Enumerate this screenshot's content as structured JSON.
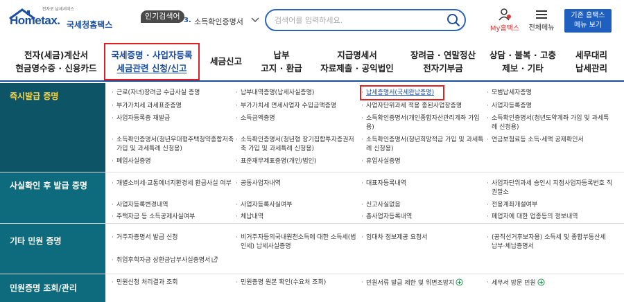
{
  "header": {
    "logo_slogan": "전자로 납세서비스",
    "logo_text": "Hometax.",
    "logo_org": "국세청홈택스",
    "popular_label": "인기검색어",
    "popular_rank": "3.",
    "popular_term": "소득확인증명서",
    "search_placeholder": "검색어를 입력하세요.",
    "my_hometax": "My홈택스",
    "all_menu": "전체메뉴",
    "classic_line1": "기존 홈택스",
    "classic_line2": "메뉴 보기"
  },
  "gnb": [
    {
      "line1": "전자(세금)계산서",
      "line2": "현금영수증 · 신용카드"
    },
    {
      "line1": "국세증명 · 사업자등록",
      "line2": "세금관련 신청/신고"
    },
    {
      "line1": "세금신고",
      "line2": ""
    },
    {
      "line1": "납부",
      "line2": "고지 · 환급"
    },
    {
      "line1": "지급명세서",
      "line2": "자료제출 · 공익법인"
    },
    {
      "line1": "장려금 · 연말정산",
      "line2": "전자기부금"
    },
    {
      "line1": "상담 · 불복 · 고충",
      "line2": "제보 · 기타"
    },
    {
      "line1": "세무대리",
      "line2": "납세관리"
    }
  ],
  "categories": [
    "즉시발급 증명",
    "사실확인 후 발급 증명",
    "기타 민원 증명",
    "민원증명 조회/관리"
  ],
  "items": {
    "c1": [
      "근로(자녀)장려금 수급사실 증명",
      "납부내역증명(납세사실증명)",
      "납세증명서(국세완납증명)",
      "모범납세자증명",
      "부가가치세 과세표준증명",
      "부가가치세 면세사업자 수입금액증명",
      "사업자단위과세 적용 종된사업장증명",
      "사업자등록증명",
      "사업자등록증 재발급",
      "소득금액증명",
      "소득확인증명서(개인종합자산관리계좌 가입용)",
      "소득확인증명서(청년도약계좌 가입 및 과세특례 신청용)",
      "소득확인증명서(청년우대형주택청약종합저축 가입 및 과세특례 신청용)",
      "소득확인증명서(청년형 장기집합투자증권저축 가입 및 과세특례 신청용)",
      "소득확인증명서(청년희망적금 가입 및 과세특례 신청용)",
      "연금보험료등 소득·세액 공제확인서",
      "폐업사실증명",
      "표준재무제표증명(개인/법인)",
      "휴업사실증명"
    ],
    "c2": [
      "개별소비세·교통에너지환경세 환급사실 여부",
      "공동사업자내역",
      "대표자등록내역",
      "사업자단위과세 승인시 지점사업자등록번호 직권말소",
      "사업자등록변경내역",
      "사업자등록사실여부",
      "신고사실없음",
      "전용계좌개설여부",
      "주택자금 등 소득공제사실여부",
      "체납내역",
      "총사업자등록내역",
      "폐업자에 대한 업종등의 정보내역"
    ],
    "c3": [
      "거주자증명서 발급 신청",
      "비거주자등의국내원천소득에 대한 소득세(법인세) 납세사실증명",
      "임대차 정보제공 요청서",
      "(공직선거후보자용) 소득세 및 종합부동산세 납부·체납증명서",
      "취업후학자금 상환금납부사실증명서"
    ],
    "c4": [
      "민원신청 처리결과 조회",
      "민원증명 원본 확인(수요처 조회)",
      "민원서류 발급 제한 및 위변조방지",
      "세무서 방문 민원"
    ]
  }
}
